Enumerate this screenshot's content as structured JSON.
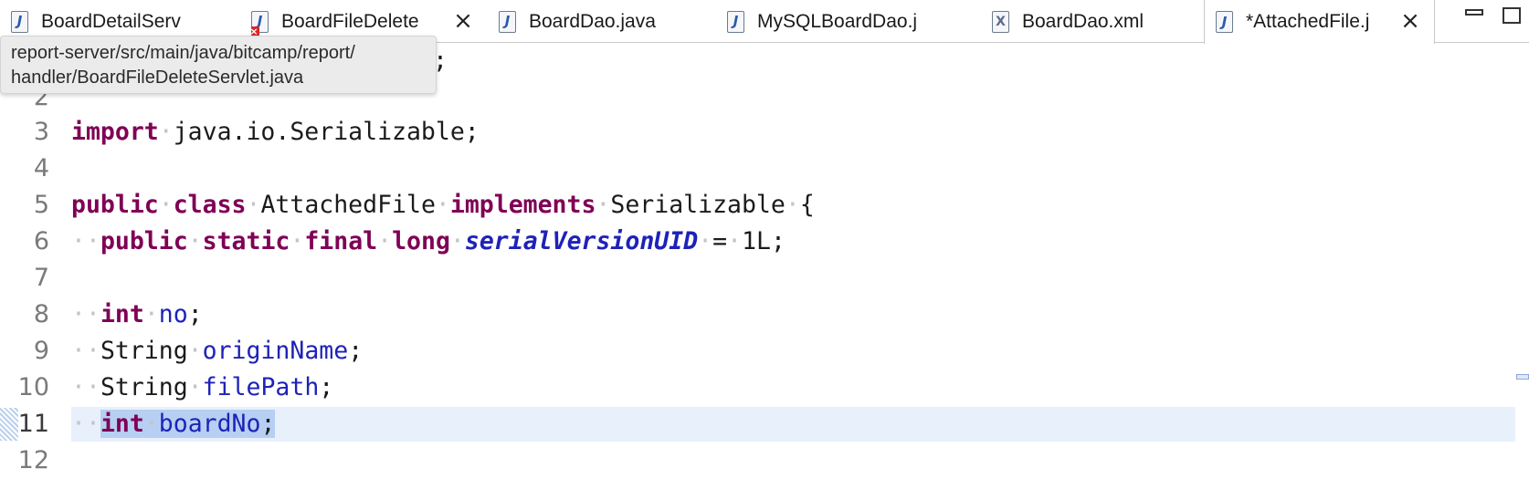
{
  "tabs": [
    {
      "label": "BoardDetailServ",
      "icon": "java-file-icon",
      "active": false
    },
    {
      "label": "BoardFileDelete",
      "icon": "java-file-error-icon",
      "active": false,
      "closable": true
    },
    {
      "label": "BoardDao.java",
      "icon": "java-file-icon",
      "active": false
    },
    {
      "label": "MySQLBoardDao.j",
      "icon": "java-file-icon",
      "active": false
    },
    {
      "label": "BoardDao.xml",
      "icon": "xml-file-icon",
      "active": false
    },
    {
      "label": "*AttachedFile.j",
      "icon": "java-file-icon",
      "active": true,
      "closable": true
    }
  ],
  "tab_icon_glyphs": {
    "java": "J",
    "xml": "X"
  },
  "tab_close_glyph": "×",
  "tooltip": {
    "line1": "report-server/src/main/java/bitcamp/report/",
    "line2": "handler/BoardFileDeleteServlet.java"
  },
  "editor": {
    "peek_line1_tail": ";",
    "line_numbers": [
      "2",
      "3",
      "4",
      "5",
      "6",
      "7",
      "8",
      "9",
      "10",
      "11",
      "12"
    ],
    "current_line": "11",
    "tokens": {
      "import_kw": "import",
      "import_path": "java.io.Serializable;",
      "public_kw": "public",
      "class_kw": "class",
      "class_name": "AttachedFile",
      "implements_kw": "implements",
      "interface_name": "Serializable",
      "open_brace": "{",
      "static_kw": "static",
      "final_kw": "final",
      "long_kw": "long",
      "serial_field": "serialVersionUID",
      "equals": "=",
      "serial_value": "1L;",
      "int_kw": "int",
      "field_no": "no",
      "string_type": "String",
      "field_origin": "originName",
      "field_path": "filePath",
      "field_board": "boardNo",
      "semicolon": ";",
      "ws_dot": "·"
    }
  },
  "colors": {
    "keyword": "#7f0055",
    "field": "#1e22b8",
    "current_line_bg": "#e8f0fc",
    "selection_bg": "#b6cff2"
  }
}
